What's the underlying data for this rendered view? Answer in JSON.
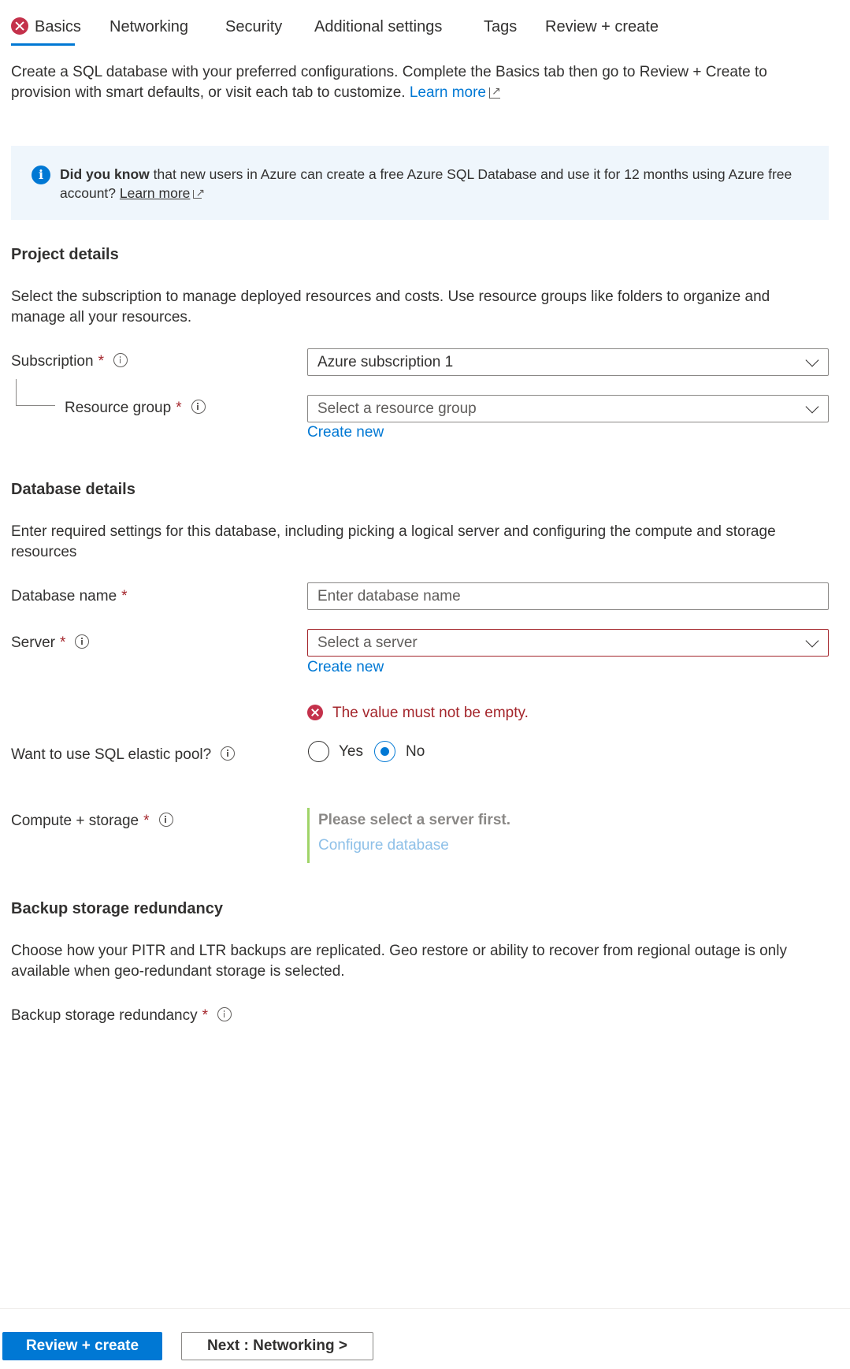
{
  "tabs": [
    {
      "label": "Basics",
      "has_error": true,
      "active": true
    },
    {
      "label": "Networking"
    },
    {
      "label": "Security"
    },
    {
      "label": "Additional settings"
    },
    {
      "label": "Tags"
    },
    {
      "label": "Review + create"
    }
  ],
  "intro": {
    "line1": "Create a SQL database with your preferred configurations. Complete the Basics tab then go to Review + Create to",
    "line2": "provision with smart defaults, or visit each tab to customize.",
    "link": "Learn more"
  },
  "banner": {
    "bold": "Did you know",
    "text": " that new users in Azure can create a free Azure SQL Database and use it for 12 months using Azure free",
    "text2": "account?",
    "link": "Learn more"
  },
  "project": {
    "title": "Project details",
    "desc1": "Select the subscription to manage deployed resources and costs. Use resource groups like folders to organize and",
    "desc2": "manage all your resources.",
    "subscription_label": "Subscription",
    "subscription_value": "Azure subscription 1",
    "rg_label": "Resource group",
    "rg_placeholder": "Select a resource group",
    "create_new": "Create new"
  },
  "database": {
    "title": "Database details",
    "desc1": "Enter required settings for this database, including picking a logical server and configuring the compute and storage",
    "desc2": "resources",
    "name_label": "Database name",
    "name_placeholder": "Enter database name",
    "server_label": "Server",
    "server_placeholder": "Select a server",
    "create_new": "Create new",
    "error": "The value must not be empty.",
    "pool_label": "Want to use SQL elastic pool?",
    "yes": "Yes",
    "no": "No",
    "compute_label": "Compute + storage",
    "compute_note": "Please select a server first.",
    "configure_link": "Configure database"
  },
  "backup": {
    "title": "Backup storage redundancy",
    "desc1": "Choose how your PITR and LTR backups are replicated. Geo restore or ability to recover from regional outage is only",
    "desc2": "available when geo-redundant storage is selected.",
    "label": "Backup storage redundancy"
  },
  "required_mark": "*",
  "footer": {
    "primary": "Review + create",
    "secondary": "Next : Networking >"
  },
  "colors": {
    "accent": "#0078d4",
    "error": "#a4262c",
    "banner_bg": "#eff6fc"
  }
}
